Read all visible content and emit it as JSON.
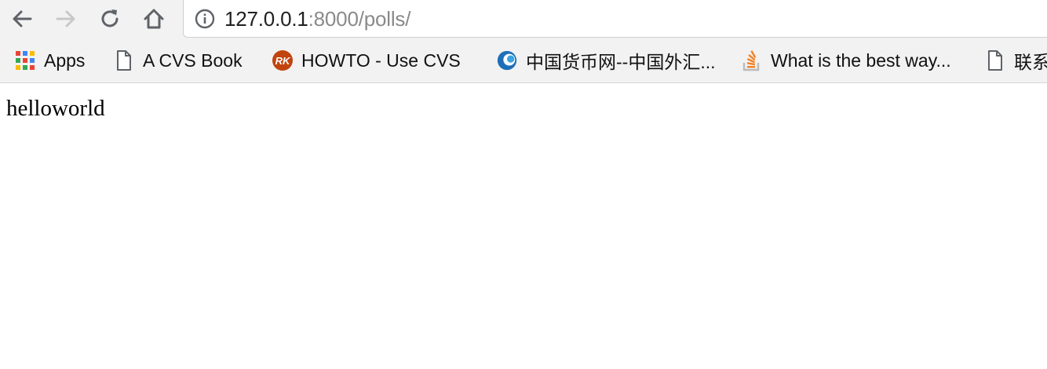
{
  "browser": {
    "url": {
      "host": "127.0.0.1",
      "rest": ":8000/polls/"
    },
    "bookmarks": [
      {
        "label": "Apps",
        "icon": "apps-grid-icon"
      },
      {
        "label": "A CVS Book",
        "icon": "page-icon"
      },
      {
        "label": "HOWTO - Use CVS",
        "icon": "rk-logo-icon"
      },
      {
        "label": "中国货币网--中国外汇...",
        "icon": "chinamoney-logo-icon"
      },
      {
        "label": "What is the best way...",
        "icon": "stackoverflow-icon"
      },
      {
        "label": "联系",
        "icon": "page-icon"
      }
    ]
  },
  "page": {
    "body_text": "helloworld"
  }
}
